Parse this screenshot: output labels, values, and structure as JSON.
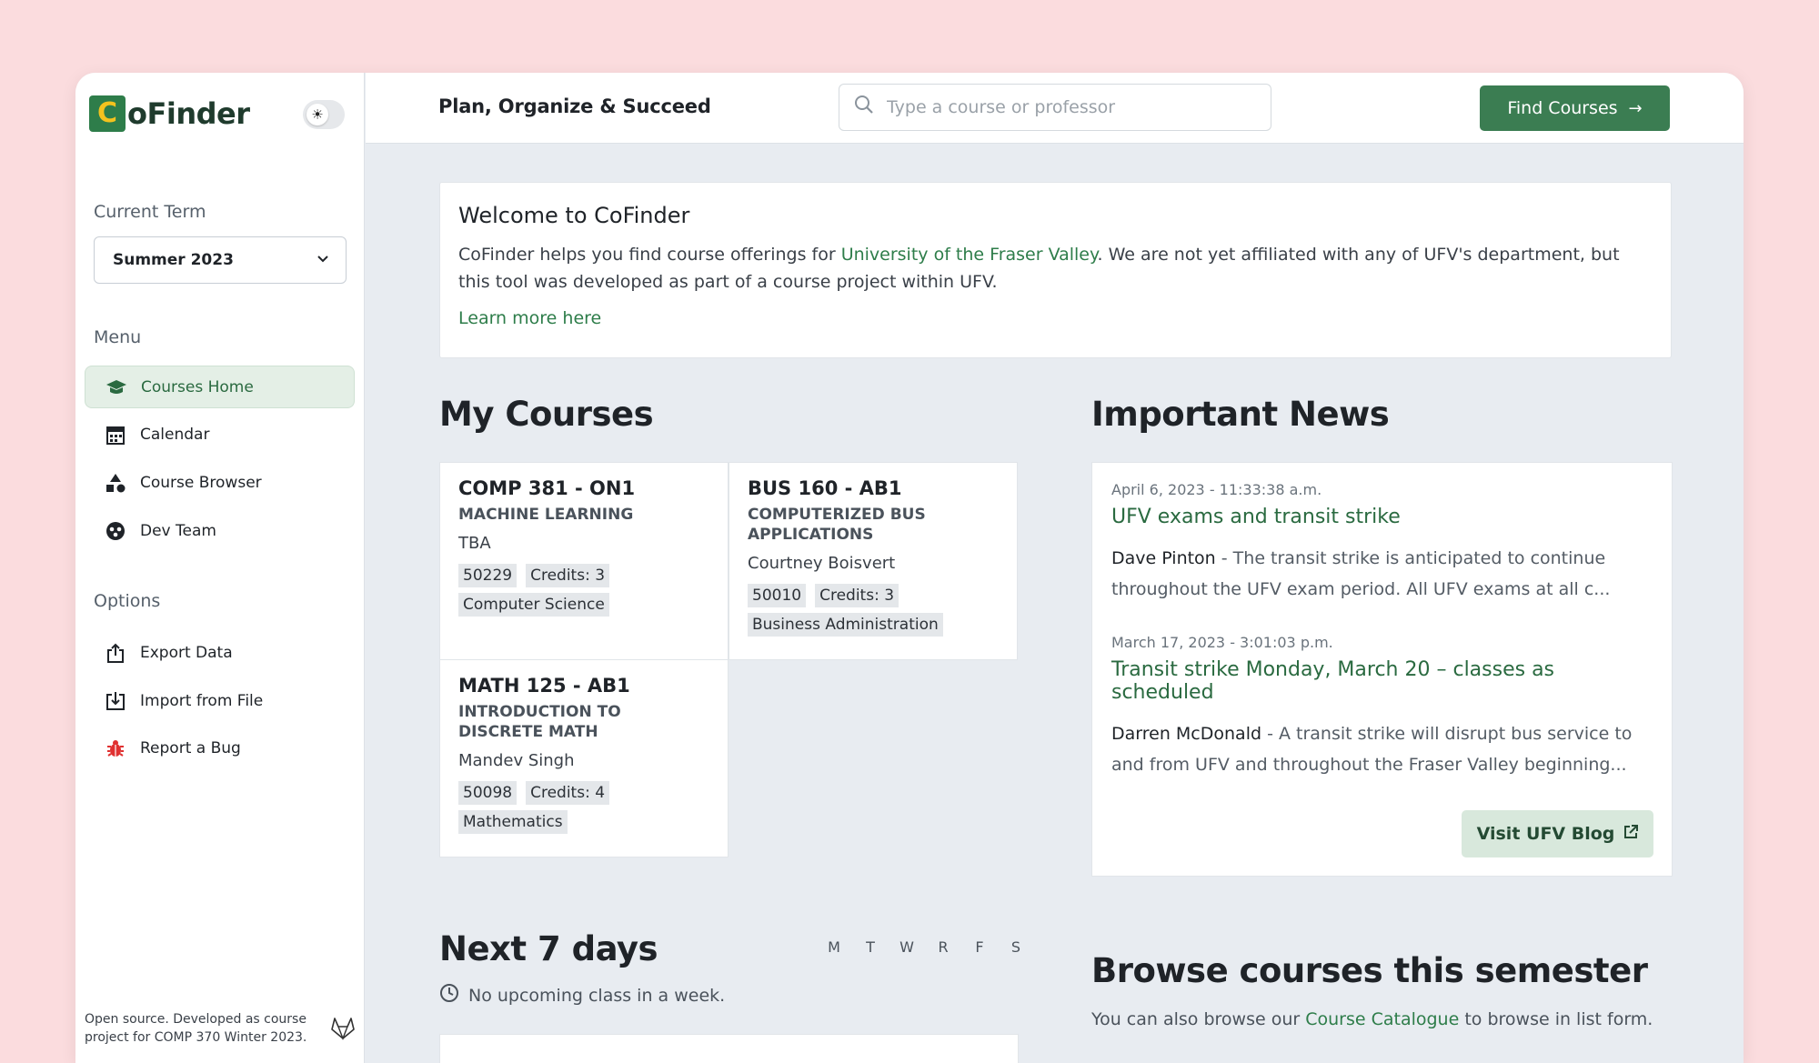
{
  "app": {
    "logo_letter": "C",
    "logo_text": "oFinder",
    "theme_icon": "sun-icon",
    "tagline": "Plan, Organize & Succeed"
  },
  "search": {
    "placeholder": "Type a course or professor"
  },
  "find_button": {
    "label": "Find Courses",
    "arrow": "→"
  },
  "sidebar": {
    "current_term_label": "Current Term",
    "term_value": "Summer 2023",
    "menu_label": "Menu",
    "menu": [
      {
        "label": "Courses Home",
        "icon": "graduation-cap-icon",
        "active": true
      },
      {
        "label": "Calendar",
        "icon": "calendar-icon"
      },
      {
        "label": "Course Browser",
        "icon": "shapes-icon"
      },
      {
        "label": "Dev Team",
        "icon": "people-icon"
      }
    ],
    "options_label": "Options",
    "options": [
      {
        "label": "Export Data",
        "icon": "export-icon"
      },
      {
        "label": "Import from File",
        "icon": "import-icon"
      },
      {
        "label": "Report a Bug",
        "icon": "bug-icon"
      }
    ],
    "footer": "Open source. Developed as course project for COMP 370 Winter 2023."
  },
  "welcome": {
    "title": "Welcome to CoFinder",
    "text_before": "CoFinder helps you find course offerings for ",
    "link_text": "University of the Fraser Valley",
    "text_after": ". We are not yet affiliated with any of UFV's department, but this tool was developed as part of a course project within UFV.",
    "learn_more": "Learn more here"
  },
  "my_courses": {
    "heading": "My Courses",
    "courses": [
      {
        "code": "COMP 381 - ON1",
        "title": "MACHINE LEARNING",
        "prof": "TBA",
        "crn": "50229",
        "credits": "Credits: 3",
        "dept": "Computer Science"
      },
      {
        "code": "BUS 160 - AB1",
        "title": "COMPUTERIZED BUS APPLICATIONS",
        "prof": "Courtney Boisvert",
        "crn": "50010",
        "credits": "Credits: 3",
        "dept": "Business Administration"
      },
      {
        "code": "MATH 125 - AB1",
        "title": "INTRODUCTION TO DISCRETE MATH",
        "prof": "Mandev Singh",
        "crn": "50098",
        "credits": "Credits: 4",
        "dept": "Mathematics"
      }
    ]
  },
  "news": {
    "heading": "Important News",
    "items": [
      {
        "date": "April 6, 2023 - 11:33:38 a.m.",
        "title": "UFV exams and transit strike",
        "author": "Dave Pinton",
        "body": " - The transit strike is anticipated to continue throughout the UFV exam period. All UFV exams at all c..."
      },
      {
        "date": "March 17, 2023 - 3:01:03 p.m.",
        "title": "Transit strike Monday, March 20 – classes as scheduled",
        "author": "Darren McDonald",
        "body": " - A transit strike will disrupt bus service to and from UFV and throughout the Fraser Valley beginning..."
      }
    ],
    "blog_button": "Visit UFV Blog"
  },
  "next7": {
    "heading": "Next 7 days",
    "days": [
      "M",
      "T",
      "W",
      "R",
      "F",
      "S"
    ],
    "empty": "No upcoming class in a week."
  },
  "browse": {
    "heading": "Browse courses this semester",
    "text_before": "You can also browse our ",
    "link_text": "Course Catalogue",
    "text_after": " to browse in list form."
  }
}
